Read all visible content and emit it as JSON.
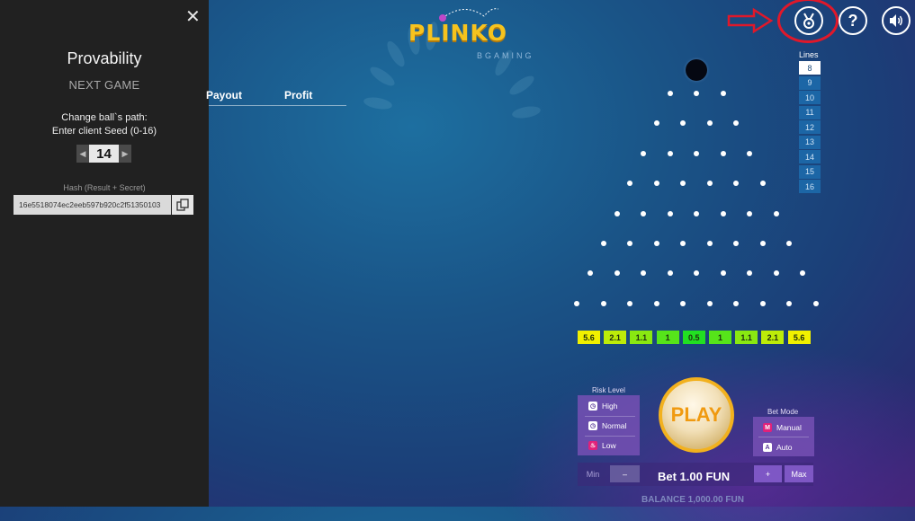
{
  "panel": {
    "close_icon": "close-icon",
    "title": "Provability",
    "subtitle": "NEXT GAME",
    "hint_line1": "Change ball`s path:",
    "hint_line2": "Enter client Seed (0-16)",
    "seed_value": "14",
    "hash_label": "Hash (Result + Secret)",
    "hash_value": "16e5518074ec2eeb597b920c2f51350103"
  },
  "tabs": {
    "payout": "Payout",
    "profit": "Profit"
  },
  "logo": {
    "text": "PLINKO",
    "brand": "BGAMING"
  },
  "topbar": {
    "help_label": "?",
    "icons": [
      "provably-fair-medal-icon",
      "help-icon",
      "sound-icon"
    ]
  },
  "lines": {
    "label": "Lines",
    "options": [
      "8",
      "9",
      "10",
      "11",
      "12",
      "13",
      "14",
      "15",
      "16"
    ],
    "selected": "8"
  },
  "multipliers": [
    "5.6",
    "2.1",
    "1.1",
    "1",
    "0.5",
    "1",
    "1.1",
    "2.1",
    "5.6"
  ],
  "risk": {
    "label": "Risk Level",
    "options": [
      "High",
      "Normal",
      "Low"
    ]
  },
  "play_label": "PLAY",
  "bet_mode": {
    "label": "Bet Mode",
    "options": [
      "Manual",
      "Auto"
    ]
  },
  "bet": {
    "min_label": "Min",
    "minus_label": "–",
    "text": "Bet 1.00 FUN",
    "plus_label": "+",
    "max_label": "Max"
  },
  "balance": "BALANCE 1,000.00 FUN",
  "colors": {
    "panel_bg": "#212121",
    "accent_gold": "#f6c31e",
    "mult_edge": "#f0f000",
    "mult_center": "#22e022"
  }
}
